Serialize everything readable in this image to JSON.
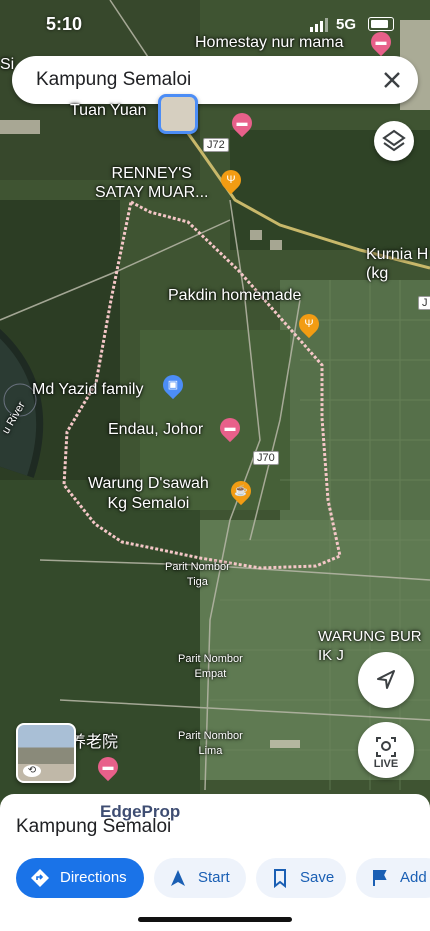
{
  "status": {
    "time": "5:10",
    "network": "5G"
  },
  "search": {
    "query": "Kampung Semaloi",
    "clear_icon": "close-icon"
  },
  "map": {
    "places": [
      {
        "name": "Homestay nur mama",
        "icon": "hotel-icon"
      },
      {
        "name": "Tuan Yuan"
      },
      {
        "name": "RENNEY'S\nSATAY MUAR...",
        "icon": "restaurant-icon"
      },
      {
        "name": "Kurnia H\n(kg"
      },
      {
        "name": "Pakdin homemade",
        "icon": "restaurant-icon"
      },
      {
        "name": "Md Yazid family",
        "icon": "shopping-icon"
      },
      {
        "name": "Endau, Johor",
        "icon": "hotel-icon"
      },
      {
        "name": "Warung D'sawah\nKg Semaloi",
        "icon": "cafe-icon"
      },
      {
        "name": "WARUNG BUR\nIK J"
      },
      {
        "name": "Si"
      }
    ],
    "small_labels": [
      "Parit Nombor\nTiga",
      "Parit Nombor\nEmpat",
      "Parit Nombor\nLima",
      "u River",
      "养老院"
    ],
    "roads": [
      "J72",
      "J70",
      "J"
    ],
    "layers_icon": "layers-icon",
    "location_icon": "navigation-arrow-icon",
    "live_label": "LIVE",
    "live_icon": "live-view-icon",
    "streetview_icon": "street-view-icon"
  },
  "sheet": {
    "title": "Kampung Semaloi",
    "watermark": "EdgeProp",
    "actions": [
      {
        "label": "Directions",
        "icon": "directions-icon"
      },
      {
        "label": "Start",
        "icon": "navigation-icon"
      },
      {
        "label": "Save",
        "icon": "bookmark-icon"
      },
      {
        "label": "Add",
        "icon": "flag-icon"
      }
    ]
  },
  "colors": {
    "accent": "#1a73e8",
    "pin_red": "#e8608a",
    "pin_orange": "#f29c13",
    "pin_blue": "#4c8df6",
    "boundary": "#f4c7c7"
  }
}
